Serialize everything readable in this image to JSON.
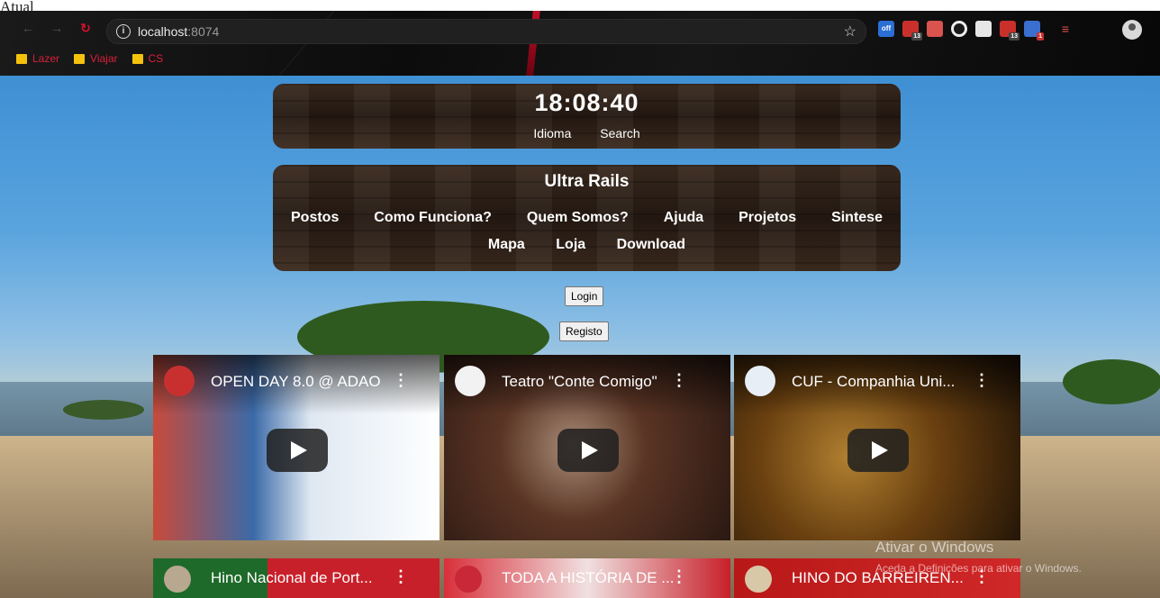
{
  "caption": "Atual",
  "browser": {
    "url_host": "localhost",
    "url_port": ":8074",
    "bookmarks": [
      "Lazer",
      "Viajar",
      "CS"
    ],
    "extensions": [
      {
        "name": "gnu-off-icon",
        "label": "off",
        "color": "#2a6fd6"
      },
      {
        "name": "red-badge-ext-icon",
        "label": "13",
        "color": "#c9302c"
      },
      {
        "name": "chart-ext-icon",
        "label": "",
        "color": "#d9534f"
      },
      {
        "name": "circle-ext-icon",
        "label": "",
        "color": "#1a1a1a"
      },
      {
        "name": "square-ext-icon",
        "label": "",
        "color": "#e6e6e6"
      },
      {
        "name": "red-badge-ext-icon-2",
        "label": "13",
        "color": "#c9302c"
      },
      {
        "name": "blue-ext-icon",
        "label": "1",
        "color": "#3b6fcf"
      },
      {
        "name": "list-ext-icon",
        "label": "",
        "color": "#d9534f"
      }
    ]
  },
  "clock": {
    "time": "18:08:40",
    "links": [
      "Idioma",
      "Search"
    ]
  },
  "menu": {
    "title": "Ultra Rails",
    "row1": [
      "Postos",
      "Como Funciona?",
      "Quem Somos?",
      "Ajuda",
      "Projetos",
      "Sintese"
    ],
    "row2": [
      "Mapa",
      "Loja",
      "Download"
    ]
  },
  "auth": {
    "login": "Login",
    "register": "Registo"
  },
  "videos": [
    {
      "title": "OPEN DAY 8.0 @ ADAO"
    },
    {
      "title": "Teatro \"Conte Comigo\""
    },
    {
      "title": "CUF - Companhia Uni..."
    },
    {
      "title": "Hino Nacional de Port..."
    },
    {
      "title": "TODA A HISTÓRIA DE ..."
    },
    {
      "title": "HINO DO BARREIREN..."
    }
  ],
  "watermark": {
    "line1": "Ativar o Windows",
    "line2": "Aceda a Definições para ativar o Windows."
  }
}
